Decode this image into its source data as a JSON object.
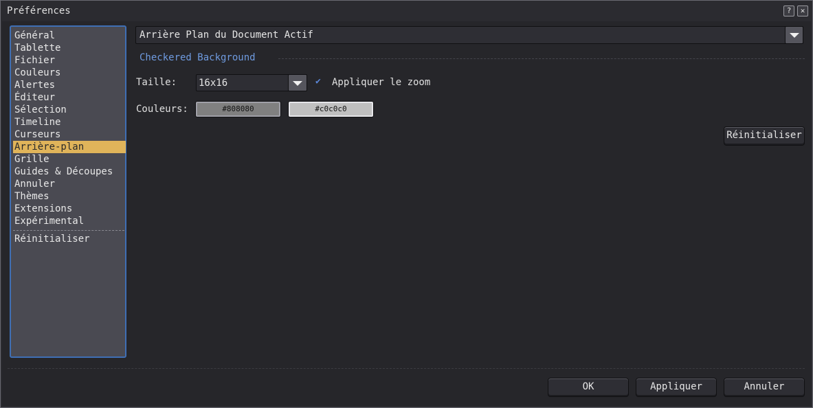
{
  "window": {
    "title": "Préférences",
    "help_icon": "?",
    "close_icon": "✕"
  },
  "sidebar": {
    "items": [
      {
        "label": "Général"
      },
      {
        "label": "Tablette"
      },
      {
        "label": "Fichier"
      },
      {
        "label": "Couleurs"
      },
      {
        "label": "Alertes"
      },
      {
        "label": "Éditeur"
      },
      {
        "label": "Sélection"
      },
      {
        "label": "Timeline"
      },
      {
        "label": "Curseurs"
      },
      {
        "label": "Arrière-plan",
        "active": true
      },
      {
        "label": "Grille"
      },
      {
        "label": "Guides & Découpes"
      },
      {
        "label": "Annuler"
      },
      {
        "label": "Thèmes"
      },
      {
        "label": "Extensions"
      },
      {
        "label": "Expérimental"
      }
    ],
    "reset_label": "Réinitialiser",
    "active_color": "#e0b45a",
    "border_color": "#3f6fb5"
  },
  "main": {
    "section_select": "Arrière Plan du Document Actif",
    "group_title": "Checkered Background",
    "size_label": "Taille:",
    "size_value": "16x16",
    "zoom_checkbox": {
      "label": "Appliquer le zoom",
      "checked": true
    },
    "colors_label": "Couleurs:",
    "color1": "#808080",
    "color2": "#c0c0c0",
    "reset_button": "Réinitialiser",
    "accent_color": "#6f9be0"
  },
  "footer": {
    "ok": "OK",
    "apply": "Appliquer",
    "cancel": "Annuler"
  }
}
